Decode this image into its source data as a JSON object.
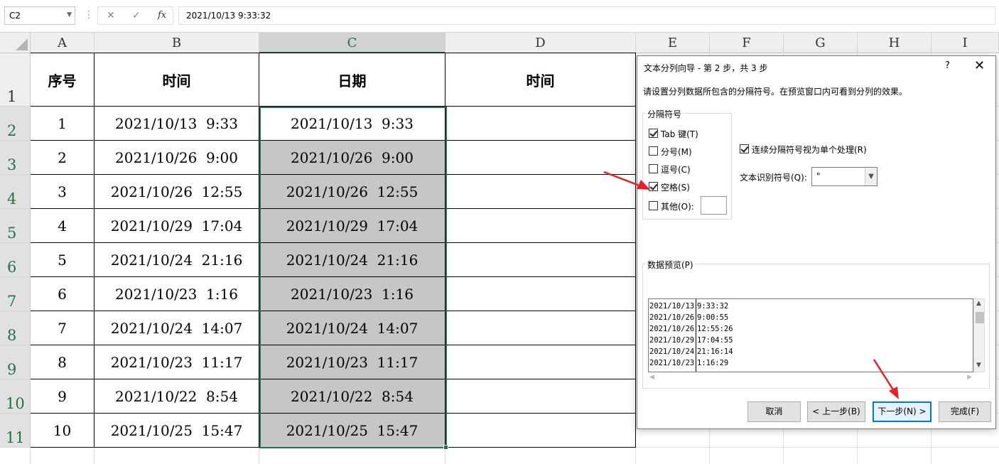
{
  "formula_bar": {
    "name_box": "C2",
    "cancel_icon": "✕",
    "enter_icon": "✓",
    "fx_label": "fx",
    "formula": "2021/10/13  9:33:32"
  },
  "columns": [
    "A",
    "B",
    "C",
    "D",
    "E",
    "F",
    "G",
    "H",
    "I"
  ],
  "rows": [
    "1",
    "2",
    "3",
    "4",
    "5",
    "6",
    "7",
    "8",
    "9",
    "10",
    "11"
  ],
  "table": {
    "headers": [
      "序号",
      "时间",
      "日期",
      "时间"
    ],
    "data": [
      [
        "1",
        "2021/10/13  9:33",
        "2021/10/13  9:33"
      ],
      [
        "2",
        "2021/10/26  9:00",
        "2021/10/26  9:00"
      ],
      [
        "3",
        "2021/10/26  12:55",
        "2021/10/26  12:55"
      ],
      [
        "4",
        "2021/10/29  17:04",
        "2021/10/29  17:04"
      ],
      [
        "5",
        "2021/10/24  21:16",
        "2021/10/24  21:16"
      ],
      [
        "6",
        "2021/10/23  1:16",
        "2021/10/23  1:16"
      ],
      [
        "7",
        "2021/10/24  14:07",
        "2021/10/24  14:07"
      ],
      [
        "8",
        "2021/10/23  11:17",
        "2021/10/23  11:17"
      ],
      [
        "9",
        "2021/10/22  8:54",
        "2021/10/22  8:54"
      ],
      [
        "10",
        "2021/10/25  15:47",
        "2021/10/25  15:47"
      ]
    ]
  },
  "dialog": {
    "title": "文本分列向导 - 第 2 步，共 3 步",
    "help": "?",
    "close": "✕",
    "description": "请设置分列数据所包含的分隔符号。在预览窗口内可看到分列的效果。",
    "delimiters_group_label": "分隔符号",
    "delimiters": [
      {
        "label": "Tab 键(T)",
        "checked": true
      },
      {
        "label": "分号(M)",
        "checked": false
      },
      {
        "label": "逗号(C)",
        "checked": false
      },
      {
        "label": "空格(S)",
        "checked": true
      },
      {
        "label": "其他(O):",
        "checked": false
      }
    ],
    "consecutive_label": "连续分隔符号视为单个处理(R)",
    "consecutive_checked": true,
    "text_qualifier_label": "文本识别符号(Q):",
    "text_qualifier_value": "\"",
    "preview_label": "数据预览(P)",
    "preview_rows": [
      [
        "2021/10/13",
        "9:33:32"
      ],
      [
        "2021/10/26",
        "9:00:55"
      ],
      [
        "2021/10/26",
        "12:55:26"
      ],
      [
        "2021/10/29",
        "17:04:55"
      ],
      [
        "2021/10/24",
        "21:16:14"
      ],
      [
        "2021/10/23",
        "1:16:29"
      ]
    ],
    "buttons": {
      "cancel": "取消",
      "back": "< 上一步(B)",
      "next": "下一步(N) >",
      "finish": "完成(F)"
    }
  },
  "colors": {
    "accent": "#217346",
    "selection_fill": "#c6c6c6",
    "annotation_arrow": "#e8202a",
    "primary_button_border": "#0078d7"
  }
}
